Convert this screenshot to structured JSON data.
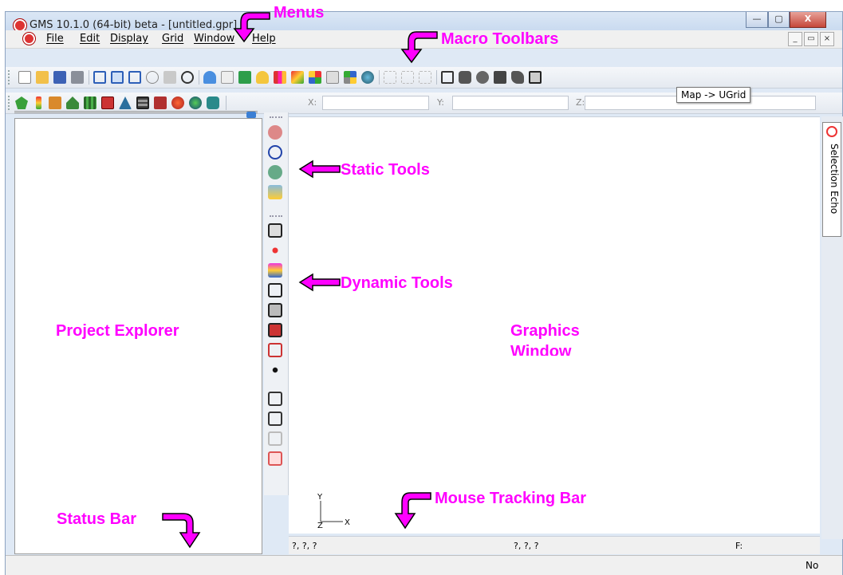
{
  "window": {
    "title": "GMS 10.1.0 (64-bit) beta - [untitled.gpr]",
    "buttons": {
      "minimize": "—",
      "maximize": "▢",
      "close": "X"
    }
  },
  "menubar": {
    "items": [
      "File",
      "Edit",
      "Display",
      "Grid",
      "Window",
      "Help"
    ],
    "mdi_buttons": [
      "_",
      "▭",
      "×"
    ]
  },
  "toolbar": {
    "coordinates": {
      "x_label": "X:",
      "y_label": "Y:",
      "z_label": "Z:",
      "x_value": "",
      "y_value": "",
      "z_value": ""
    },
    "tooltip": "Map -> UGrid"
  },
  "panels": {
    "selection_echo_label": "Selection Echo"
  },
  "tracking_bar": {
    "left_value": "?, ?, ?",
    "middle_value": "?, ?, ?",
    "right_label": "F:"
  },
  "statusbar": {
    "right_text": "No"
  },
  "axes": {
    "y_label": "Y",
    "x_label": "X",
    "z_label": "Z"
  },
  "annotations": {
    "menus": "Menus",
    "macro_toolbars": "Macro Toolbars",
    "static_tools": "Static Tools",
    "dynamic_tools": "Dynamic Tools",
    "project_explorer": "Project Explorer",
    "graphics_window_line1": "Graphics",
    "graphics_window_line2": "Window",
    "mouse_tracking_bar": "Mouse Tracking Bar",
    "status_bar": "Status Bar"
  },
  "colors": {
    "annotation": "#ff00ff",
    "titlebar": "#c3d6ee",
    "panel": "#f0f0f0"
  }
}
